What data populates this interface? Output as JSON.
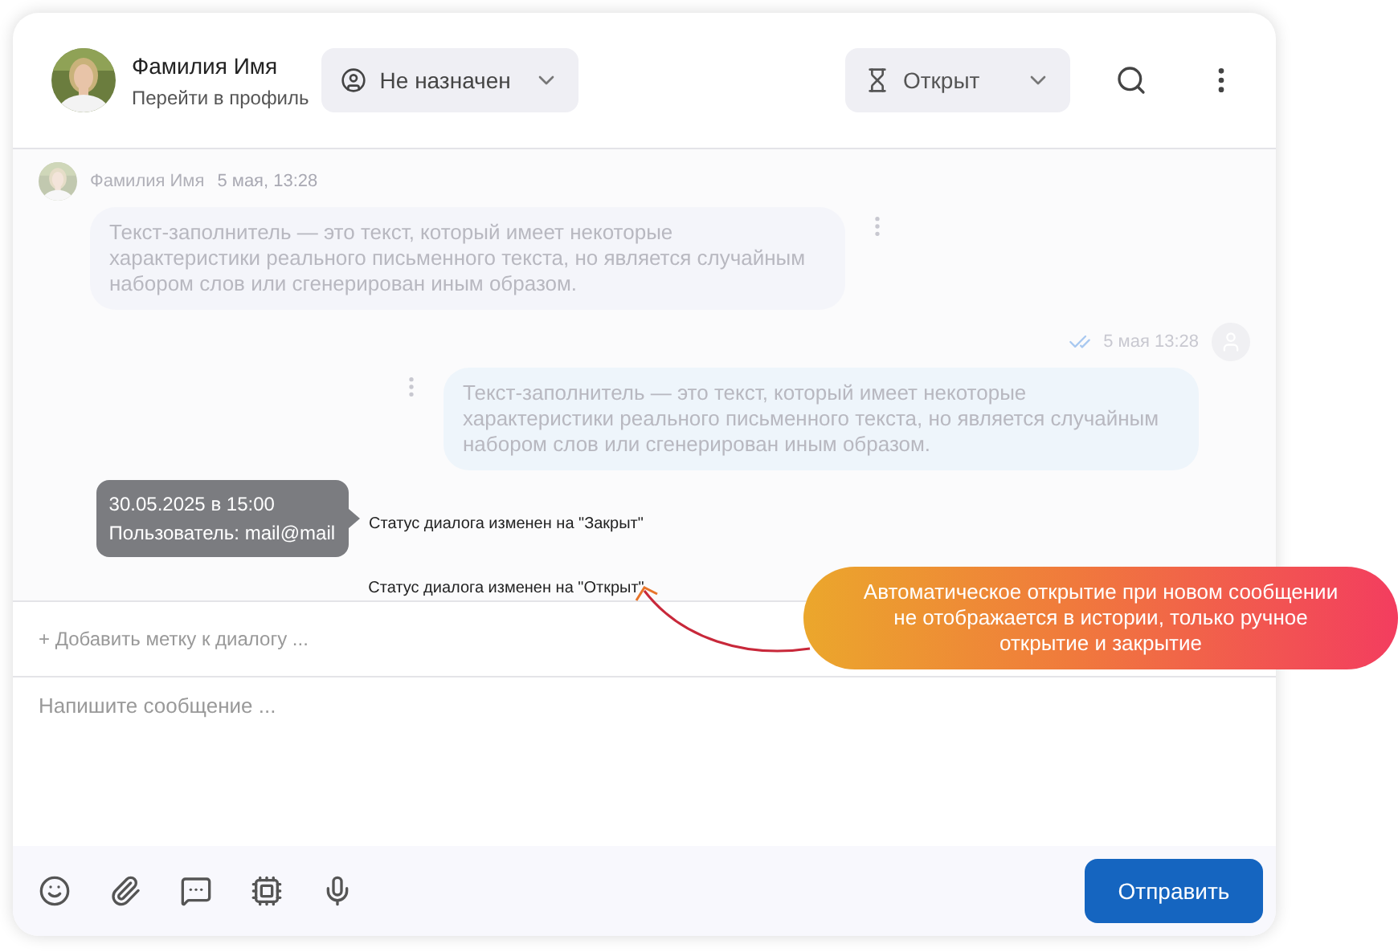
{
  "header": {
    "name": "Фамилия Имя",
    "profile_link": "Перейти в профиль",
    "assignee": "Не назначен",
    "status": "Открыт"
  },
  "messages": [
    {
      "kind": "incoming",
      "author": "Фамилия Имя",
      "time": "5 мая, 13:28",
      "text": "Текст-заполнитель — это текст, который имеет некоторые характеристики реального письменного текста, но является случайным набором слов или сгенерирован иным образом."
    },
    {
      "kind": "outgoing",
      "time": "5 мая 13:28",
      "read": true,
      "text": "Текст-заполнитель — это текст, который имеет некоторые характеристики реального письменного текста, но является случайным набором слов или сгенерирован иным образом."
    }
  ],
  "status_events": [
    {
      "text": "Статус диалога изменен на \"Закрыт\"",
      "tooltip": {
        "date": "30.05.2025 в 15:00",
        "user": "Пользователь: mail@mail"
      }
    },
    {
      "text": "Статус диалога изменен на \"Открыт\""
    }
  ],
  "add_tag": "+ Добавить метку к диалогу ...",
  "composer": {
    "placeholder": "Напишите сообщение ..."
  },
  "send_button": "Отправить",
  "callout": "Автоматическое открытие при новом сообщении не отображается в истории, только ручное открытие и закрытие"
}
